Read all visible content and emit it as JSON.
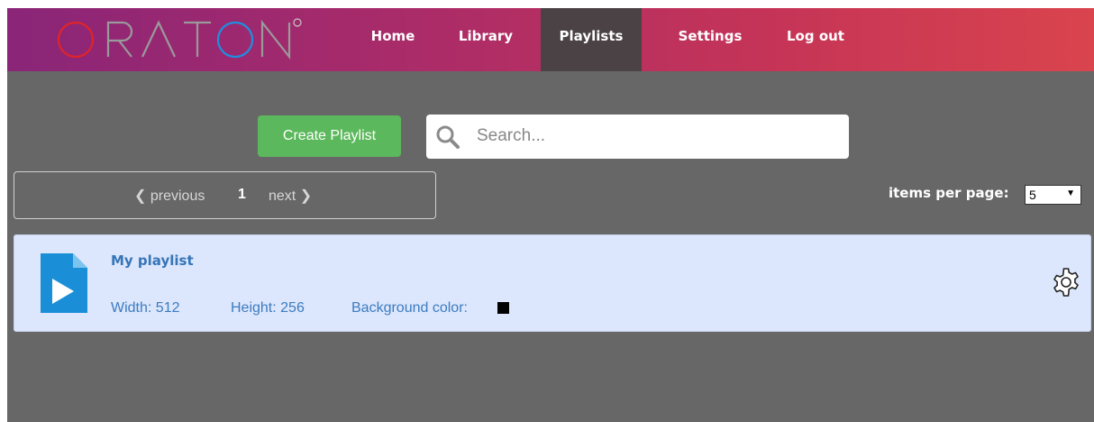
{
  "brand": {
    "name": "ORATON",
    "colors": {
      "O_first": "#e02428",
      "O_second": "#1e8fe0",
      "trademark": "#c8c8c8"
    }
  },
  "nav": {
    "items": [
      {
        "label": "Home",
        "active": false
      },
      {
        "label": "Library",
        "active": false
      },
      {
        "label": "Playlists",
        "active": true
      },
      {
        "label": "Settings",
        "active": false
      },
      {
        "label": "Log out",
        "active": false
      }
    ]
  },
  "toolbar": {
    "create_label": "Create Playlist",
    "search_placeholder": "Search...",
    "search_icon": "search-icon"
  },
  "pagination": {
    "prev_label": "previous",
    "current_page": "1",
    "next_label": "next",
    "items_per_page_label": "items per page:",
    "items_per_page_value": "5"
  },
  "playlists": [
    {
      "title": "My playlist",
      "width_text": "Width: 512",
      "height_text": "Height: 256",
      "background_label": "Background color:",
      "background_color": "#000000",
      "icon": "play-file-icon",
      "action_icon": "gear-icon"
    }
  ],
  "theme": {
    "header_gradient": [
      "#8a2578",
      "#d9444d"
    ],
    "page_bg": "#676767",
    "active_nav_bg": "#4a4245",
    "button_green": "#5cb85c",
    "card_bg": "#dce6fc",
    "link_blue": "#3575b8"
  }
}
